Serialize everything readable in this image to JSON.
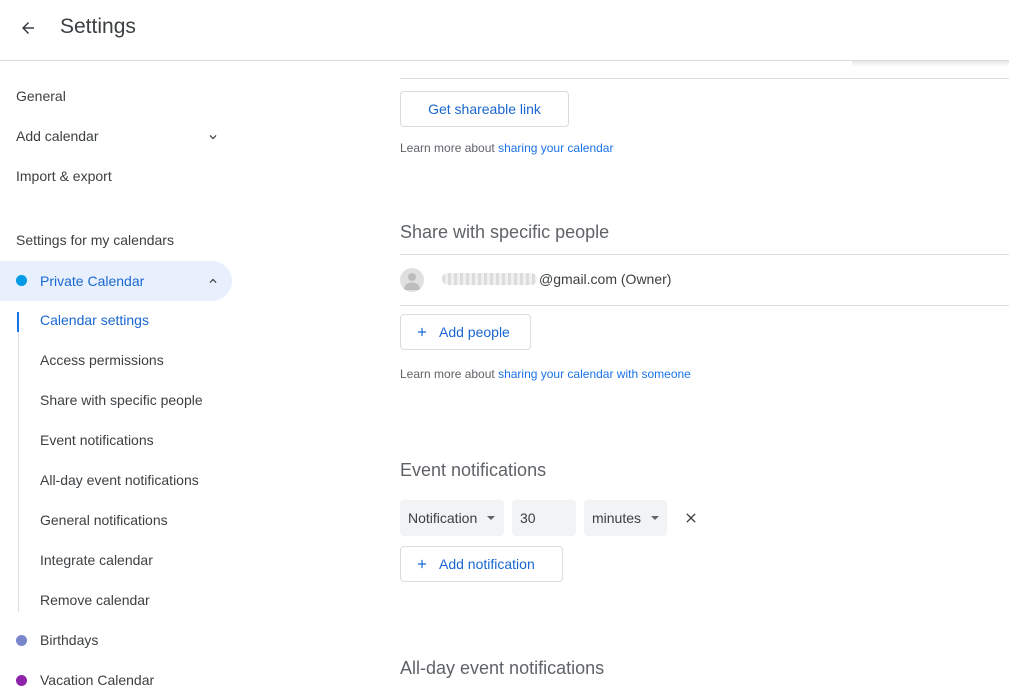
{
  "header": {
    "title": "Settings"
  },
  "sidebar": {
    "general": "General",
    "add_calendar": "Add calendar",
    "import_export": "Import & export",
    "section_label": "Settings for my calendars",
    "active_calendar": {
      "name": "Private Calendar",
      "color": "#039be5"
    },
    "sub_items": [
      "Calendar settings",
      "Access permissions",
      "Share with specific people",
      "Event notifications",
      "All-day event notifications",
      "General notifications",
      "Integrate calendar",
      "Remove calendar"
    ],
    "other_calendars": [
      {
        "name": "Birthdays",
        "color": "#7986cb"
      },
      {
        "name": "Vacation Calendar",
        "color": "#8e24aa"
      }
    ]
  },
  "main": {
    "share_link_button": "Get shareable link",
    "learn_more_prefix": "Learn more about ",
    "learn_more_link_1": "sharing your calendar",
    "share_section_title": "Share with specific people",
    "owner_email": "@gmail.com (Owner)",
    "add_people_button": "Add people",
    "learn_more_link_2": "sharing your calendar with someone",
    "event_notifications_title": "Event notifications",
    "notification_type": "Notification",
    "notification_value": "30",
    "notification_unit": "minutes",
    "add_notification_button": "Add notification",
    "allday_title": "All-day event notifications"
  }
}
